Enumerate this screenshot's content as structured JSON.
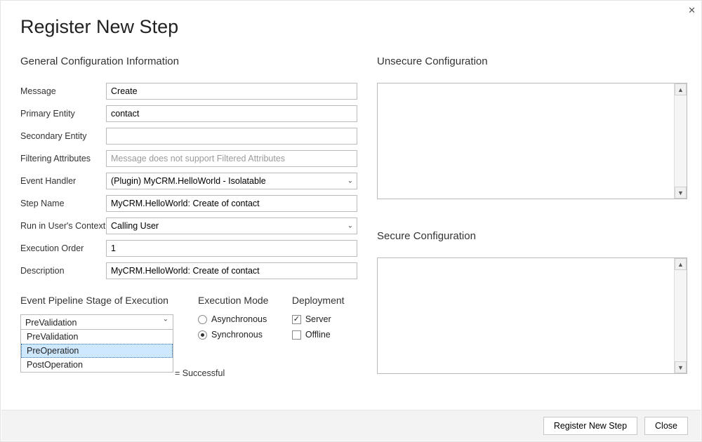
{
  "window": {
    "title": "Register New Step",
    "close_symbol": "✕"
  },
  "general": {
    "heading": "General Configuration Information",
    "labels": {
      "message": "Message",
      "primary_entity": "Primary Entity",
      "secondary_entity": "Secondary Entity",
      "filtering_attributes": "Filtering Attributes",
      "event_handler": "Event Handler",
      "step_name": "Step Name",
      "run_context": "Run in User's Context",
      "execution_order": "Execution Order",
      "description": "Description"
    },
    "values": {
      "message": "Create",
      "primary_entity": "contact",
      "secondary_entity": "",
      "filtering_attributes_placeholder": "Message does not support Filtered Attributes",
      "event_handler": "(Plugin) MyCRM.HelloWorld - Isolatable",
      "step_name": "MyCRM.HelloWorld: Create of contact",
      "run_context": "Calling User",
      "execution_order": "1",
      "description": "MyCRM.HelloWorld: Create of contact"
    }
  },
  "pipeline": {
    "heading": "Event Pipeline Stage of Execution",
    "selected": "PreValidation",
    "options": [
      "PreValidation",
      "PreOperation",
      "PostOperation"
    ],
    "highlighted_index": 1
  },
  "execmode": {
    "heading": "Execution Mode",
    "options": {
      "async": "Asynchronous",
      "sync": "Synchronous"
    },
    "selected": "sync"
  },
  "deployment": {
    "heading": "Deployment",
    "options": {
      "server": "Server",
      "offline": "Offline"
    },
    "server_checked": true,
    "offline_checked": false
  },
  "status_trailing": "= Successful",
  "unsecure": {
    "heading": "Unsecure  Configuration",
    "value": ""
  },
  "secure": {
    "heading": "Secure  Configuration",
    "value": ""
  },
  "footer": {
    "register": "Register New Step",
    "close": "Close"
  }
}
